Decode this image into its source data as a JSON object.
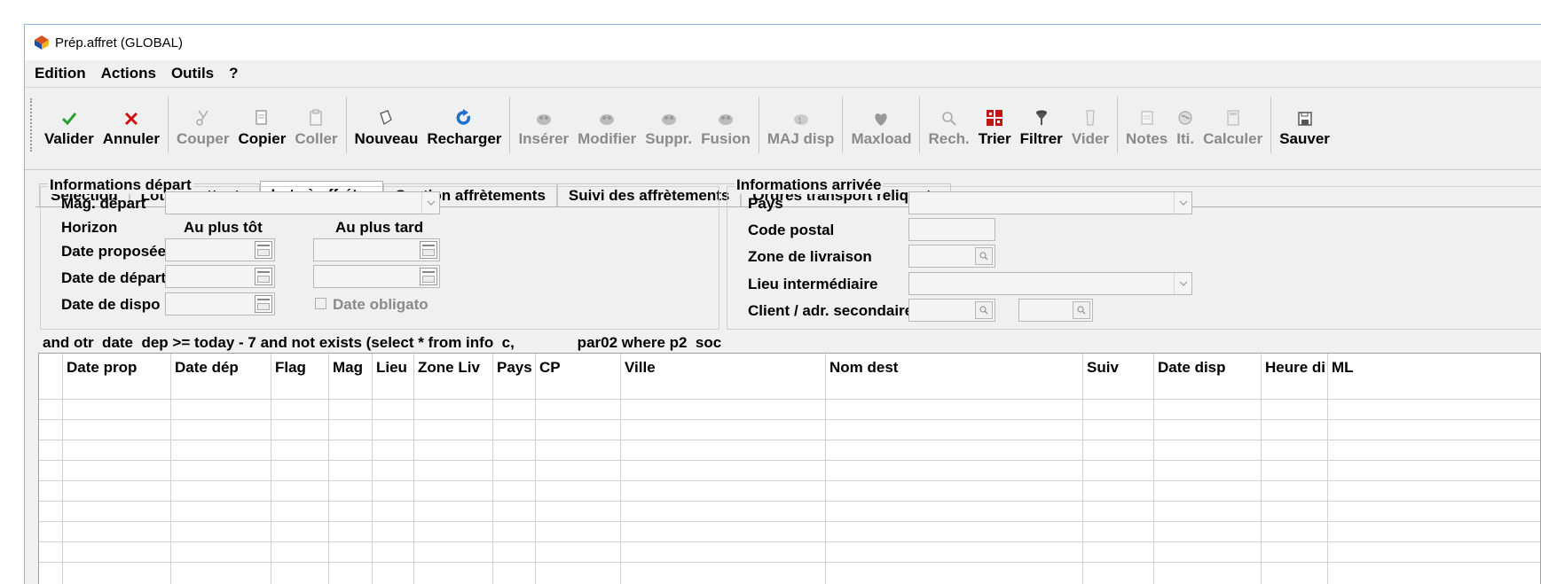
{
  "window": {
    "title": "Prép.affret (GLOBAL)"
  },
  "menu": [
    "Edition",
    "Actions",
    "Outils",
    "?"
  ],
  "toolbar": [
    {
      "label": "Valider",
      "icon": "check-icon",
      "enabled": true
    },
    {
      "label": "Annuler",
      "icon": "x-icon",
      "enabled": true
    },
    {
      "label": "Couper",
      "icon": "scissors-icon",
      "enabled": false
    },
    {
      "label": "Copier",
      "icon": "copy-icon",
      "enabled": true
    },
    {
      "label": "Coller",
      "icon": "paste-icon",
      "enabled": false
    },
    {
      "label": "Nouveau",
      "icon": "new-icon",
      "enabled": true
    },
    {
      "label": "Recharger",
      "icon": "reload-icon",
      "enabled": true
    },
    {
      "label": "Insérer",
      "icon": "insert-icon",
      "enabled": false
    },
    {
      "label": "Modifier",
      "icon": "modify-icon",
      "enabled": false
    },
    {
      "label": "Suppr.",
      "icon": "delete-icon",
      "enabled": false
    },
    {
      "label": "Fusion",
      "icon": "merge-icon",
      "enabled": false
    },
    {
      "label": "MAJ disp",
      "icon": "update-icon",
      "enabled": false
    },
    {
      "label": "Maxload",
      "icon": "maxload-icon",
      "enabled": false
    },
    {
      "label": "Rech.",
      "icon": "search-icon",
      "enabled": false
    },
    {
      "label": "Trier",
      "icon": "sort-icon",
      "enabled": true
    },
    {
      "label": "Filtrer",
      "icon": "filter-icon",
      "enabled": true
    },
    {
      "label": "Vider",
      "icon": "clear-icon",
      "enabled": false
    },
    {
      "label": "Notes",
      "icon": "notes-icon",
      "enabled": false
    },
    {
      "label": "Iti.",
      "icon": "route-icon",
      "enabled": false
    },
    {
      "label": "Calculer",
      "icon": "calculator-icon",
      "enabled": false
    },
    {
      "label": "Sauver",
      "icon": "save-icon",
      "enabled": true
    }
  ],
  "tabs": [
    "Sélection",
    "Lots en attente",
    "Lots à affréter",
    "Gestion affrètements",
    "Suivi des affrètements",
    "Ordres transport reliquats"
  ],
  "active_tab": 2,
  "depart": {
    "legend": "Informations départ",
    "mag_label": "Mag. départ",
    "horizon_label": "Horizon",
    "au_plus_tot": "Au plus tôt",
    "au_plus_tard": "Au plus tard",
    "date_proposee": "Date proposée",
    "date_depart": "Date de départ",
    "date_dispo": "Date de dispo",
    "date_obligato": "Date obligato"
  },
  "arrivee": {
    "legend": "Informations arrivée",
    "pays": "Pays",
    "code_postal": "Code postal",
    "zone_livraison": "Zone de livraison",
    "lieu_intermediaire": "Lieu intermédiaire",
    "client_adr": "Client / adr. secondaire"
  },
  "sql_text": "and otr  date  dep >= today - 7 and not exists (select * from info  c,               par02 where p2  soc",
  "grid": {
    "columns": [
      "Date prop",
      "Date dép",
      "Flag",
      "Mag",
      "Lieu",
      "Zone Liv",
      "Pays",
      "CP",
      "Ville",
      "Nom dest",
      "Suiv",
      "Date disp",
      "Heure di",
      "ML"
    ]
  },
  "colors": {
    "accent_border": "#8ab4df",
    "check_green": "#2e9e2e",
    "cancel_red": "#d01010",
    "reload_blue": "#1f6fd0"
  }
}
